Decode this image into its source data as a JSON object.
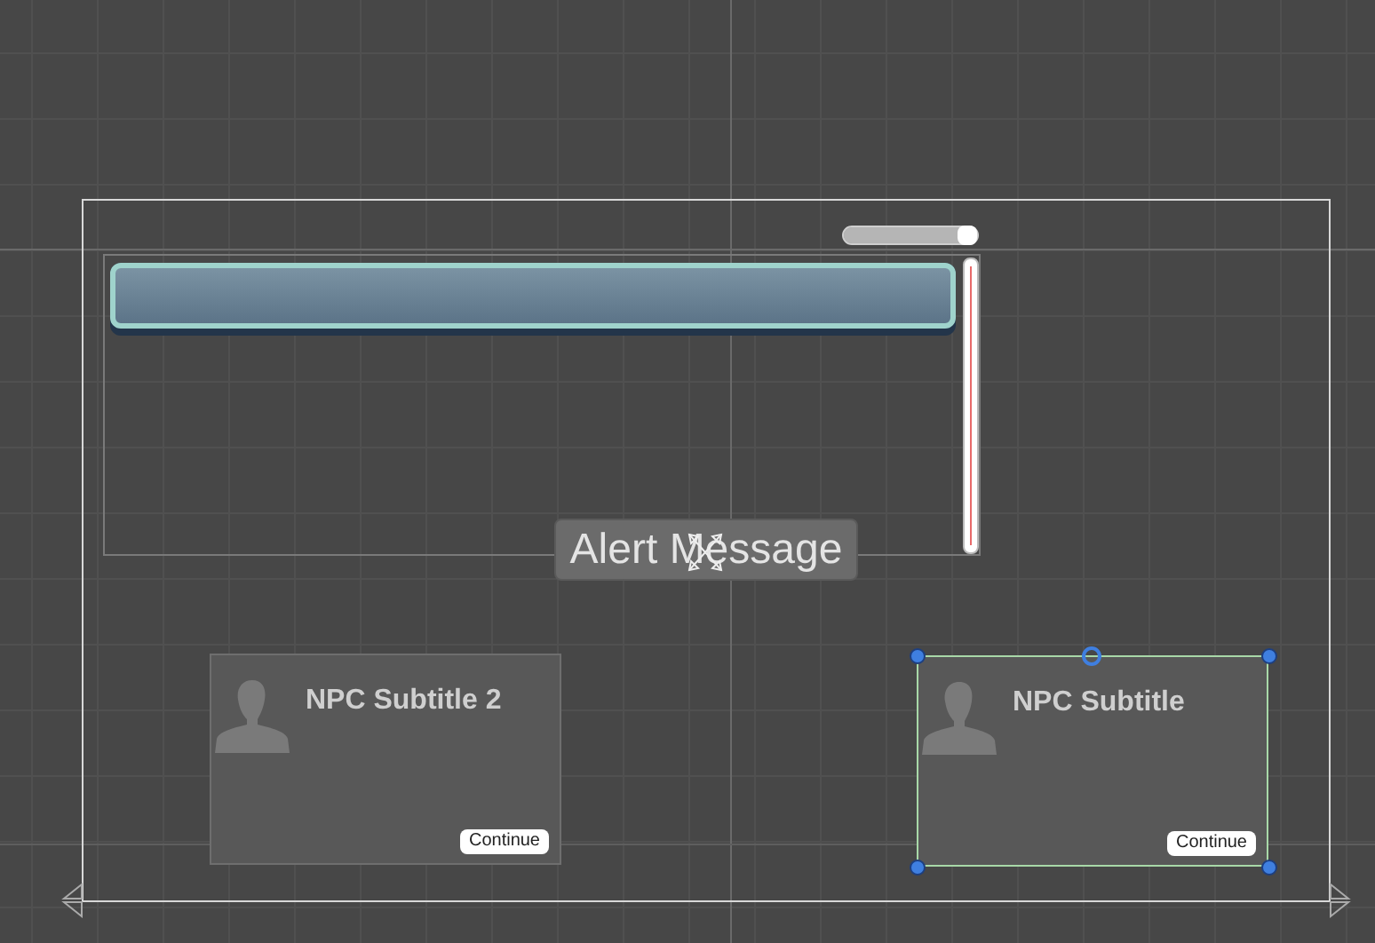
{
  "slider": {
    "level": 1.0
  },
  "alert": {
    "text": "Alert Message"
  },
  "subtitle_panels": [
    {
      "title": "NPC Subtitle 2",
      "button": "Continue",
      "selected": false
    },
    {
      "title": "NPC Subtitle",
      "button": "Continue",
      "selected": true
    }
  ]
}
